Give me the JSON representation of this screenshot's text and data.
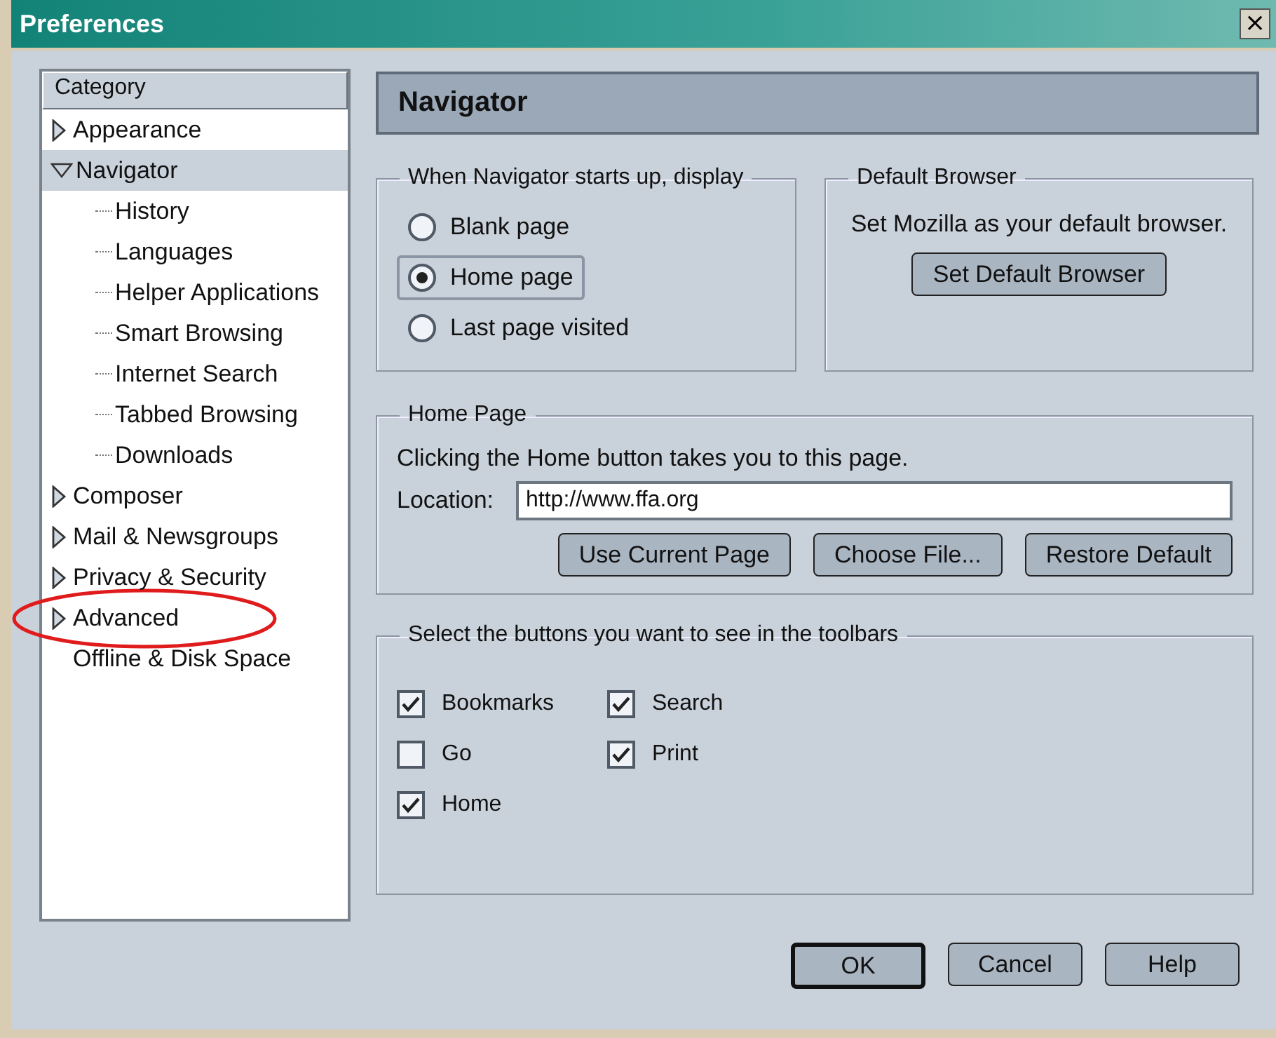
{
  "window": {
    "title": "Preferences",
    "close": "×"
  },
  "sidebar": {
    "header": "Category",
    "items": [
      {
        "label": "Appearance",
        "kind": "branch",
        "expanded": false,
        "selected": false,
        "highlighted": false
      },
      {
        "label": "Navigator",
        "kind": "branch",
        "expanded": true,
        "selected": true,
        "highlighted": false,
        "children": [
          {
            "label": "History",
            "selected": false
          },
          {
            "label": "Languages",
            "selected": false
          },
          {
            "label": "Helper Applications",
            "selected": false
          },
          {
            "label": "Smart Browsing",
            "selected": false
          },
          {
            "label": "Internet Search",
            "selected": false
          },
          {
            "label": "Tabbed Browsing",
            "selected": false
          },
          {
            "label": "Downloads",
            "selected": false
          }
        ]
      },
      {
        "label": "Composer",
        "kind": "branch",
        "expanded": false,
        "selected": false,
        "highlighted": false
      },
      {
        "label": "Mail & Newsgroups",
        "kind": "branch",
        "expanded": false,
        "selected": false,
        "highlighted": false
      },
      {
        "label": "Privacy & Security",
        "kind": "branch",
        "expanded": false,
        "selected": false,
        "highlighted": false
      },
      {
        "label": "Advanced",
        "kind": "branch",
        "expanded": false,
        "selected": false,
        "highlighted": true
      },
      {
        "label": "Offline & Disk Space",
        "kind": "leaf",
        "selected": false,
        "highlighted": false
      }
    ]
  },
  "panel": {
    "title": "Navigator",
    "startup": {
      "legend": "When Navigator starts up, display",
      "options": [
        {
          "label": "Blank page",
          "selected": false
        },
        {
          "label": "Home page",
          "selected": true
        },
        {
          "label": "Last page visited",
          "selected": false
        }
      ]
    },
    "default_browser": {
      "legend": "Default Browser",
      "text": "Set Mozilla as your default browser.",
      "button": "Set Default Browser"
    },
    "home_page": {
      "legend": "Home Page",
      "text": "Clicking the Home button takes you to this page.",
      "location_label": "Location:",
      "location_value": "http://www.ffa.org",
      "buttons": [
        "Use Current Page",
        "Choose File...",
        "Restore Default"
      ]
    },
    "toolbars": {
      "legend": "Select the buttons you want to see in the toolbars",
      "items": [
        {
          "label": "Bookmarks",
          "checked": true
        },
        {
          "label": "Go",
          "checked": false
        },
        {
          "label": "Home",
          "checked": true
        },
        {
          "label": "Search",
          "checked": true
        },
        {
          "label": "Print",
          "checked": true
        }
      ]
    }
  },
  "buttons": [
    {
      "label": "OK",
      "default": true
    },
    {
      "label": "Cancel",
      "default": false
    },
    {
      "label": "Help",
      "default": false
    }
  ]
}
